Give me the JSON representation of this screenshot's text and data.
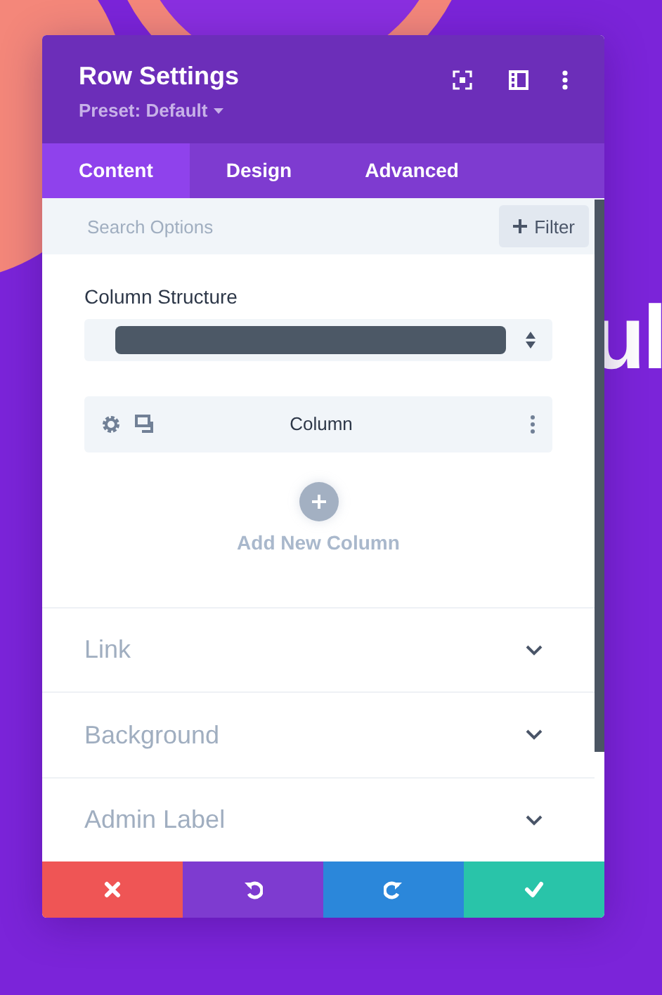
{
  "background": {
    "heading": "ul"
  },
  "window": {
    "title": "Row Settings",
    "preset": "Preset: Default"
  },
  "tabs": [
    {
      "label": "Content",
      "selected": true
    },
    {
      "label": "Design",
      "selected": false
    },
    {
      "label": "Advanced",
      "selected": false
    }
  ],
  "search": {
    "placeholder": "Search Options",
    "filter_button": "Filter"
  },
  "column_structure": {
    "label": "Column Structure"
  },
  "columns": [
    {
      "label": "Column"
    }
  ],
  "add_column": {
    "label": "Add New Column"
  },
  "sections": [
    {
      "label": "Link",
      "expanded": false
    },
    {
      "label": "Background",
      "expanded": false
    },
    {
      "label": "Admin Label",
      "expanded": false
    }
  ],
  "footer_buttons": [
    {
      "kind": "cancel"
    },
    {
      "kind": "undo"
    },
    {
      "kind": "redo"
    },
    {
      "kind": "save"
    }
  ]
}
